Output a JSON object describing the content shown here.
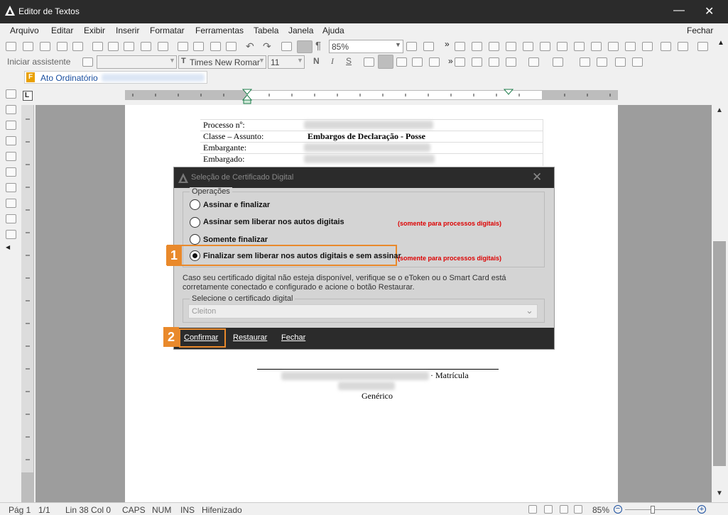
{
  "window": {
    "title": "Editor de Textos",
    "minimize": "—",
    "close": "✕"
  },
  "menu": [
    "Arquivo",
    "Editar",
    "Exibir",
    "Inserir",
    "Formatar",
    "Ferramentas",
    "Tabela",
    "Janela",
    "Ajuda"
  ],
  "menu_close": "Fechar",
  "toolbar": {
    "zoom": "85%",
    "assistant": "Iniciar assistente",
    "font": "Times New Romar",
    "size": "11",
    "bold": "N",
    "italic": "I",
    "underline": "S"
  },
  "tab": {
    "label": "Ato Ordinatório"
  },
  "document": {
    "processo": "Processo nº:",
    "classe": "Classe – Assunto:",
    "classe_val": "Embargos de Declaração - Posse",
    "embargante": "Embargante:",
    "embargado": "Embargado:",
    "matricula": "· Matrícula",
    "generico": "Genérico"
  },
  "dialog": {
    "title": "Seleção de Certificado Digital",
    "group": "Operações",
    "options": [
      "Assinar e finalizar",
      "Assinar sem liberar nos autos digitais",
      "Somente finalizar",
      "Finalizar sem liberar nos autos digitais e sem assinar"
    ],
    "note": "(somente para processos digitais)",
    "info1": "Caso seu certificado digital não esteja disponível, verifique se o eToken ou o Smart Card está",
    "info2": "corretamente conectado e configurado e acione o botão Restaurar.",
    "cert_group": "Selecione o certificado digital",
    "cert_value": "Cleiton",
    "buttons": {
      "confirm": "Confirmar",
      "restore": "Restaurar",
      "close": "Fechar"
    }
  },
  "badges": [
    "1",
    "2"
  ],
  "status": {
    "page": "Pág 1",
    "pages": "1/1",
    "pos": "Lin 38  Col 0",
    "caps": "CAPS",
    "num": "NUM",
    "ins": "INS",
    "hyph": "Hifenizado",
    "zoom": "85%"
  },
  "colors": {
    "titlebar": "#2b2b2b",
    "accent": "#e9892b",
    "warning": "#dd0000"
  }
}
